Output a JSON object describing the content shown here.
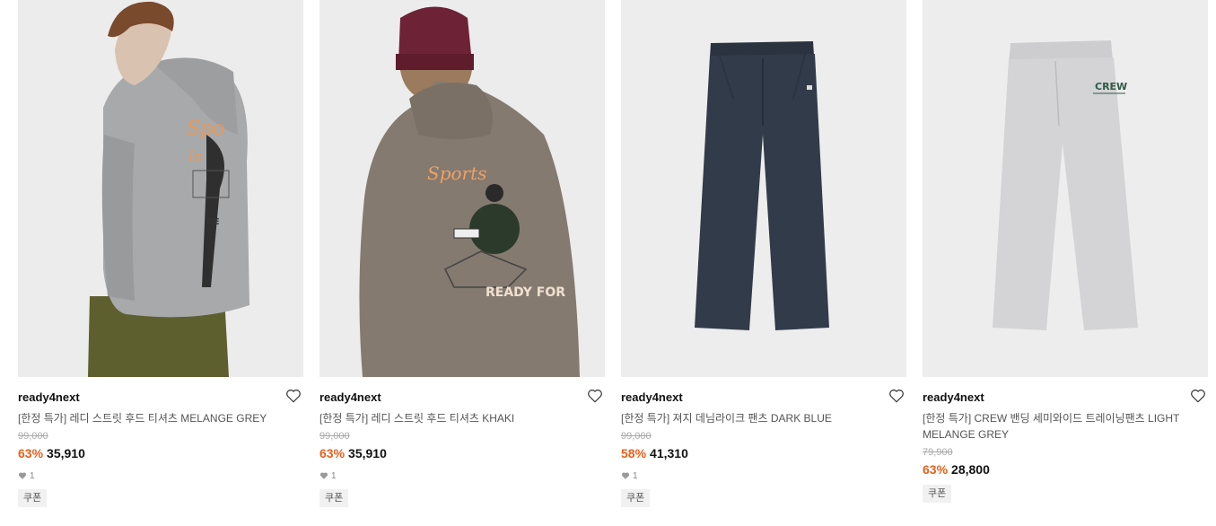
{
  "products": [
    {
      "brand": "ready4next",
      "name": "[한정 특가] 레디 스트릿 후드 티셔츠 MELANGE GREY",
      "original_price": "99,000",
      "discount": "63%",
      "price": "35,910",
      "likes": "1",
      "coupon": "쿠폰",
      "image": "melange-grey-hoodie-model-image"
    },
    {
      "brand": "ready4next",
      "name": "[한정 특가] 레디 스트릿 후드 티셔츠 KHAKI",
      "original_price": "99,000",
      "discount": "63%",
      "price": "35,910",
      "likes": "1",
      "coupon": "쿠폰",
      "image": "khaki-hoodie-model-back-image"
    },
    {
      "brand": "ready4next",
      "name": "[한정 특가] 져지 데님라이크 팬츠 DARK BLUE",
      "original_price": "99,000",
      "discount": "58%",
      "price": "41,310",
      "likes": "1",
      "coupon": "쿠폰",
      "image": "dark-blue-pants-image"
    },
    {
      "brand": "ready4next",
      "name": "[한정 특가] CREW 밴딩 세미와이드 트레이닝팬츠 LIGHT MELANGE GREY",
      "original_price": "79,900",
      "discount": "63%",
      "price": "28,800",
      "coupon": "쿠폰",
      "image": "light-grey-training-pants-image"
    }
  ],
  "colors": {
    "discount": "#e8601c",
    "original_price": "#a8a8a8",
    "coupon_bg": "#f1f1f1"
  }
}
